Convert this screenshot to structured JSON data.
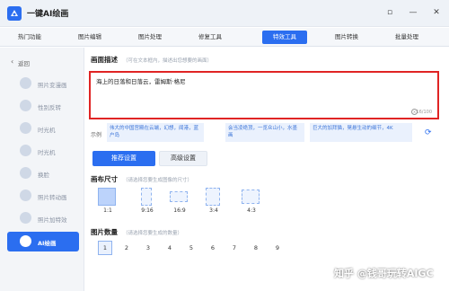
{
  "window": {
    "title": "一键AI绘画",
    "controls": [
      "▫",
      "—",
      "✕"
    ]
  },
  "tabs": [
    {
      "label": "热门功能",
      "active": false
    },
    {
      "label": "图片编辑",
      "active": false
    },
    {
      "label": "图片处理",
      "active": false
    },
    {
      "label": "修复工具",
      "active": false
    },
    {
      "label": "特效工具",
      "active": true
    },
    {
      "label": "图片转换",
      "active": false
    },
    {
      "label": "批量处理",
      "active": false
    }
  ],
  "sidebar": {
    "back_label": "返回",
    "items": [
      {
        "label": "照片变漫画",
        "active": false
      },
      {
        "label": "性别反转",
        "active": false
      },
      {
        "label": "时光机",
        "active": false
      },
      {
        "label": "时光机",
        "active": false
      },
      {
        "label": "换脸",
        "active": false
      },
      {
        "label": "照片转动画",
        "active": false
      },
      {
        "label": "照片加特效",
        "active": false
      },
      {
        "label": "AI绘画",
        "active": true
      }
    ]
  },
  "prompt": {
    "title": "画面描述",
    "hint": "（可在文本框内，描述出您想要的画面）",
    "text": "海上的日落和日落云，雷姆斯·格尼",
    "counter": "16/100"
  },
  "examples": {
    "label": "示例",
    "items": [
      "伟大的中国宫殿在云端，幻想，闻港，蓝户岛",
      "会当凌绝顶，一览众山小，水墨画",
      "巨大的加拜猫，晃悬生动的细节，4K"
    ]
  },
  "buttons": {
    "recommended": "推荐设置",
    "advanced": "高级设置"
  },
  "canvas": {
    "title": "画布尺寸",
    "hint": "（请选择您要生成图像的尺寸）",
    "options": [
      "1:1",
      "9:16",
      "16:9",
      "3:4",
      "4:3"
    ],
    "selected": "1:1"
  },
  "count": {
    "title": "图片数量",
    "hint": "（请选择您要生成的数量）",
    "options": [
      "1",
      "2",
      "3",
      "4",
      "5",
      "6",
      "7",
      "8",
      "9"
    ],
    "selected": "1"
  },
  "watermark": "知乎 @钱哥玩转AIGC",
  "colors": {
    "accent": "#2b6ef0",
    "highlight_border": "#e02424"
  }
}
